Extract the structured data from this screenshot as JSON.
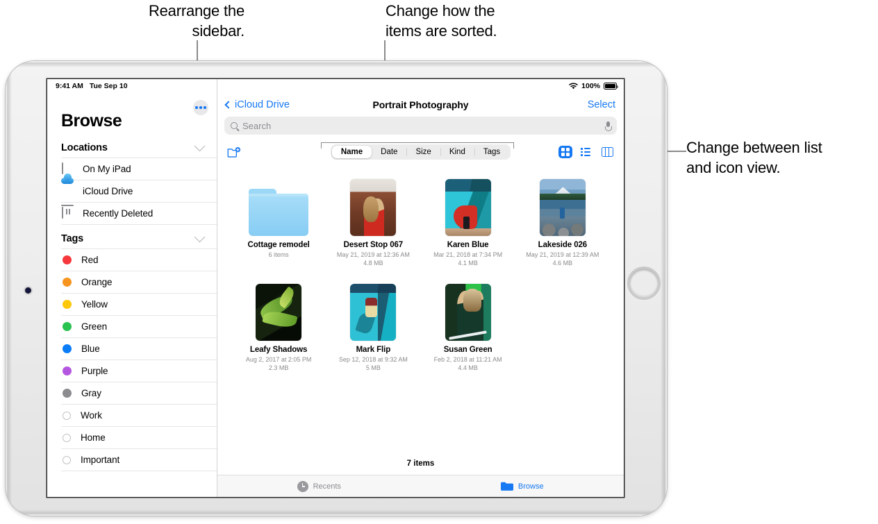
{
  "callouts": [
    {
      "name": "rearrange-sidebar",
      "text": "Rearrange the\nsidebar."
    },
    {
      "name": "change-sort",
      "text": "Change how the\nitems are sorted."
    },
    {
      "name": "change-view",
      "text": "Change between list\nand icon view."
    }
  ],
  "status_bar": {
    "time": "9:41 AM",
    "date": "Tue Sep 10",
    "battery_percent": "100%",
    "wifi_icon": "wifi-icon",
    "battery_icon": "battery-icon"
  },
  "sidebar": {
    "title": "Browse",
    "more_button_icon": "ellipsis-icon",
    "sections": [
      {
        "header": "Locations",
        "collapse_icon": "chevron-down-icon",
        "items": [
          {
            "label": "On My iPad",
            "icon": "ipad-icon"
          },
          {
            "label": "iCloud Drive",
            "icon": "icloud-icon"
          },
          {
            "label": "Recently Deleted",
            "icon": "trash-icon"
          }
        ]
      },
      {
        "header": "Tags",
        "collapse_icon": "chevron-down-icon",
        "items": [
          {
            "label": "Red",
            "color": "#f6383c",
            "icon": "tag-dot-icon"
          },
          {
            "label": "Orange",
            "color": "#f7941e",
            "icon": "tag-dot-icon"
          },
          {
            "label": "Yellow",
            "color": "#fec80a",
            "icon": "tag-dot-icon"
          },
          {
            "label": "Green",
            "color": "#28c351",
            "icon": "tag-dot-icon"
          },
          {
            "label": "Blue",
            "color": "#0a7df7",
            "icon": "tag-dot-icon"
          },
          {
            "label": "Purple",
            "color": "#b457e0",
            "icon": "tag-dot-icon"
          },
          {
            "label": "Gray",
            "color": "#8b8b90",
            "icon": "tag-dot-icon"
          },
          {
            "label": "Work",
            "color": "",
            "icon": "tag-ring-icon"
          },
          {
            "label": "Home",
            "color": "",
            "icon": "tag-ring-icon"
          },
          {
            "label": "Important",
            "color": "",
            "icon": "tag-ring-icon"
          }
        ]
      }
    ]
  },
  "navbar": {
    "back_label": "iCloud Drive",
    "back_icon": "chevron-left-icon",
    "title": "Portrait Photography",
    "select_label": "Select"
  },
  "search": {
    "placeholder": "Search",
    "search_icon": "search-icon",
    "mic_icon": "microphone-icon"
  },
  "toolbar": {
    "new_folder_icon": "new-folder-icon",
    "sort_options": [
      "Name",
      "Date",
      "Size",
      "Kind",
      "Tags"
    ],
    "sort_selected": "Name",
    "view_buttons": [
      {
        "icon": "grid-view-icon",
        "active": true
      },
      {
        "icon": "list-view-icon",
        "active": false
      },
      {
        "icon": "column-view-icon",
        "active": false
      }
    ]
  },
  "files": {
    "count_label": "7 items",
    "items": [
      {
        "name": "Cottage remodel",
        "meta1": "6 items",
        "meta2": "",
        "kind": "folder",
        "thumb_class": ""
      },
      {
        "name": "Desert Stop 067",
        "meta1": "May 21, 2019 at 12:36 AM",
        "meta2": "4.8 MB",
        "kind": "photo",
        "thumb_class": "ph-desert"
      },
      {
        "name": "Karen Blue",
        "meta1": "Mar 21, 2018 at 7:34 PM",
        "meta2": "4.1 MB",
        "kind": "photo",
        "thumb_class": "ph-karen"
      },
      {
        "name": "Lakeside 026",
        "meta1": "May 21, 2019 at 12:39 AM",
        "meta2": "4.6 MB",
        "kind": "photo",
        "thumb_class": "ph-lake"
      },
      {
        "name": "Leafy Shadows",
        "meta1": "Aug 2, 2017 at 2:05 PM",
        "meta2": "2.3 MB",
        "kind": "photo",
        "thumb_class": "ph-leafy"
      },
      {
        "name": "Mark Flip",
        "meta1": "Sep 12, 2018 at 9:32 AM",
        "meta2": "5 MB",
        "kind": "photo",
        "thumb_class": "ph-mark"
      },
      {
        "name": "Susan Green",
        "meta1": "Feb 2, 2018 at 11:21 AM",
        "meta2": "4.4 MB",
        "kind": "photo",
        "thumb_class": "ph-susan"
      }
    ]
  },
  "tabbar": {
    "tabs": [
      {
        "label": "Recents",
        "icon": "clock-icon",
        "active": false
      },
      {
        "label": "Browse",
        "icon": "folder-icon",
        "active": true
      }
    ]
  },
  "colors": {
    "accent": "#1678f2",
    "folder_blue": "#87cdf4",
    "muted_text": "#8b8b8f"
  }
}
